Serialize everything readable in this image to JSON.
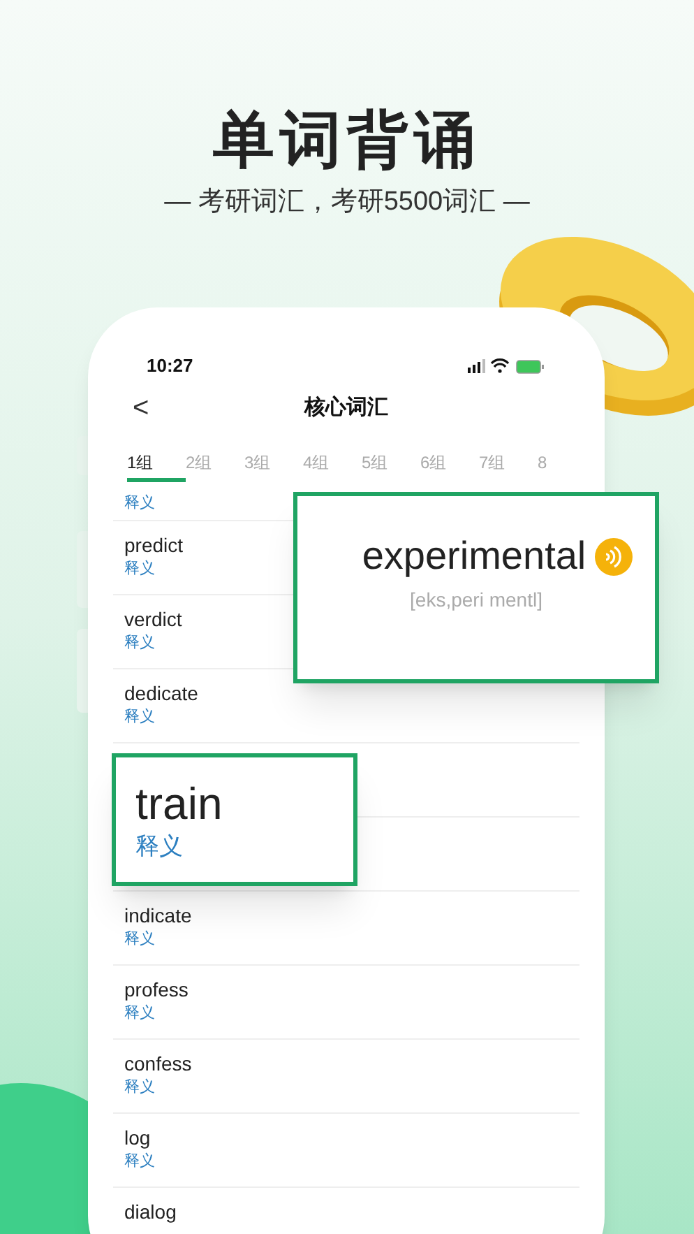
{
  "headline": "单词背诵",
  "subtitle": "— 考研词汇，考研5500词汇 —",
  "status_bar": {
    "time": "10:27"
  },
  "nav": {
    "back": "<",
    "title": "核心词汇"
  },
  "tabs": [
    {
      "label": "1组",
      "selected": true
    },
    {
      "label": "2组",
      "selected": false
    },
    {
      "label": "3组",
      "selected": false
    },
    {
      "label": "4组",
      "selected": false
    },
    {
      "label": "5组",
      "selected": false
    },
    {
      "label": "6组",
      "selected": false
    },
    {
      "label": "7组",
      "selected": false
    },
    {
      "label": "8",
      "selected": false
    }
  ],
  "words": [
    {
      "meaning": "释义"
    },
    {
      "word": "predict",
      "meaning": "释义"
    },
    {
      "word": "verdict",
      "meaning": "释义"
    },
    {
      "word": "dedicate",
      "meaning": "释义"
    },
    {
      "word": "indicate",
      "meaning": "释义"
    },
    {
      "word": "profess",
      "meaning": "释义"
    },
    {
      "word": "confess",
      "meaning": "释义"
    },
    {
      "word": "log",
      "meaning": "释义"
    },
    {
      "word": "dialog"
    }
  ],
  "word_card": {
    "word": "experimental",
    "phonetic": "[eks,peri mentl]"
  },
  "train_card": {
    "word": "train",
    "meaning": "释义"
  }
}
